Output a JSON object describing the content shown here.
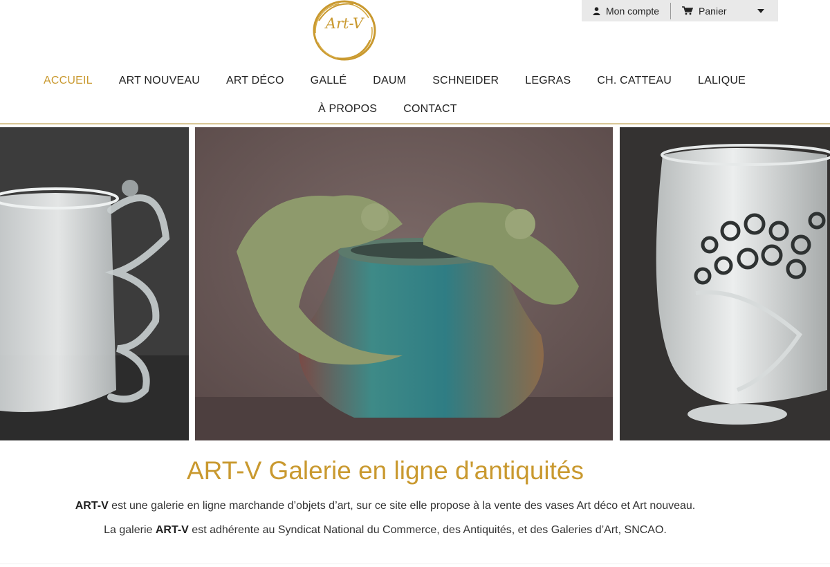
{
  "account": {
    "account_label": "Mon compte",
    "cart_label": "Panier"
  },
  "logo": {
    "text": "Art-V"
  },
  "nav": {
    "row1": [
      "ACCUEIL",
      "ART NOUVEAU",
      "ART DÉCO",
      "GALLÉ",
      "DAUM",
      "SCHNEIDER",
      "LEGRAS",
      "CH. CATTEAU",
      "LALIQUE"
    ],
    "row2": [
      "À PROPOS",
      "CONTACT"
    ],
    "active": "ACCUEIL"
  },
  "colors": {
    "accent": "#c9992f",
    "nav_text": "#222222",
    "bar_bg": "#e9e9e9"
  },
  "slider": {
    "left": "glass-cup-with-handles",
    "center": "ceramic-vase-with-panthers",
    "right": "frosted-glass-vase"
  },
  "content": {
    "heading": "ART-V Galerie en ligne d'antiquités",
    "p1_bold": "ART-V",
    "p1_text": " est une galerie en ligne marchande d’objets d’art, sur ce site elle propose à la vente des vases Art déco et Art nouveau.",
    "p2_pre": "La galerie ",
    "p2_bold": "ART-V",
    "p2_text": " est adhérente au Syndicat National du Commerce, des Antiquités, et des Galeries d’Art, SNCAO."
  }
}
